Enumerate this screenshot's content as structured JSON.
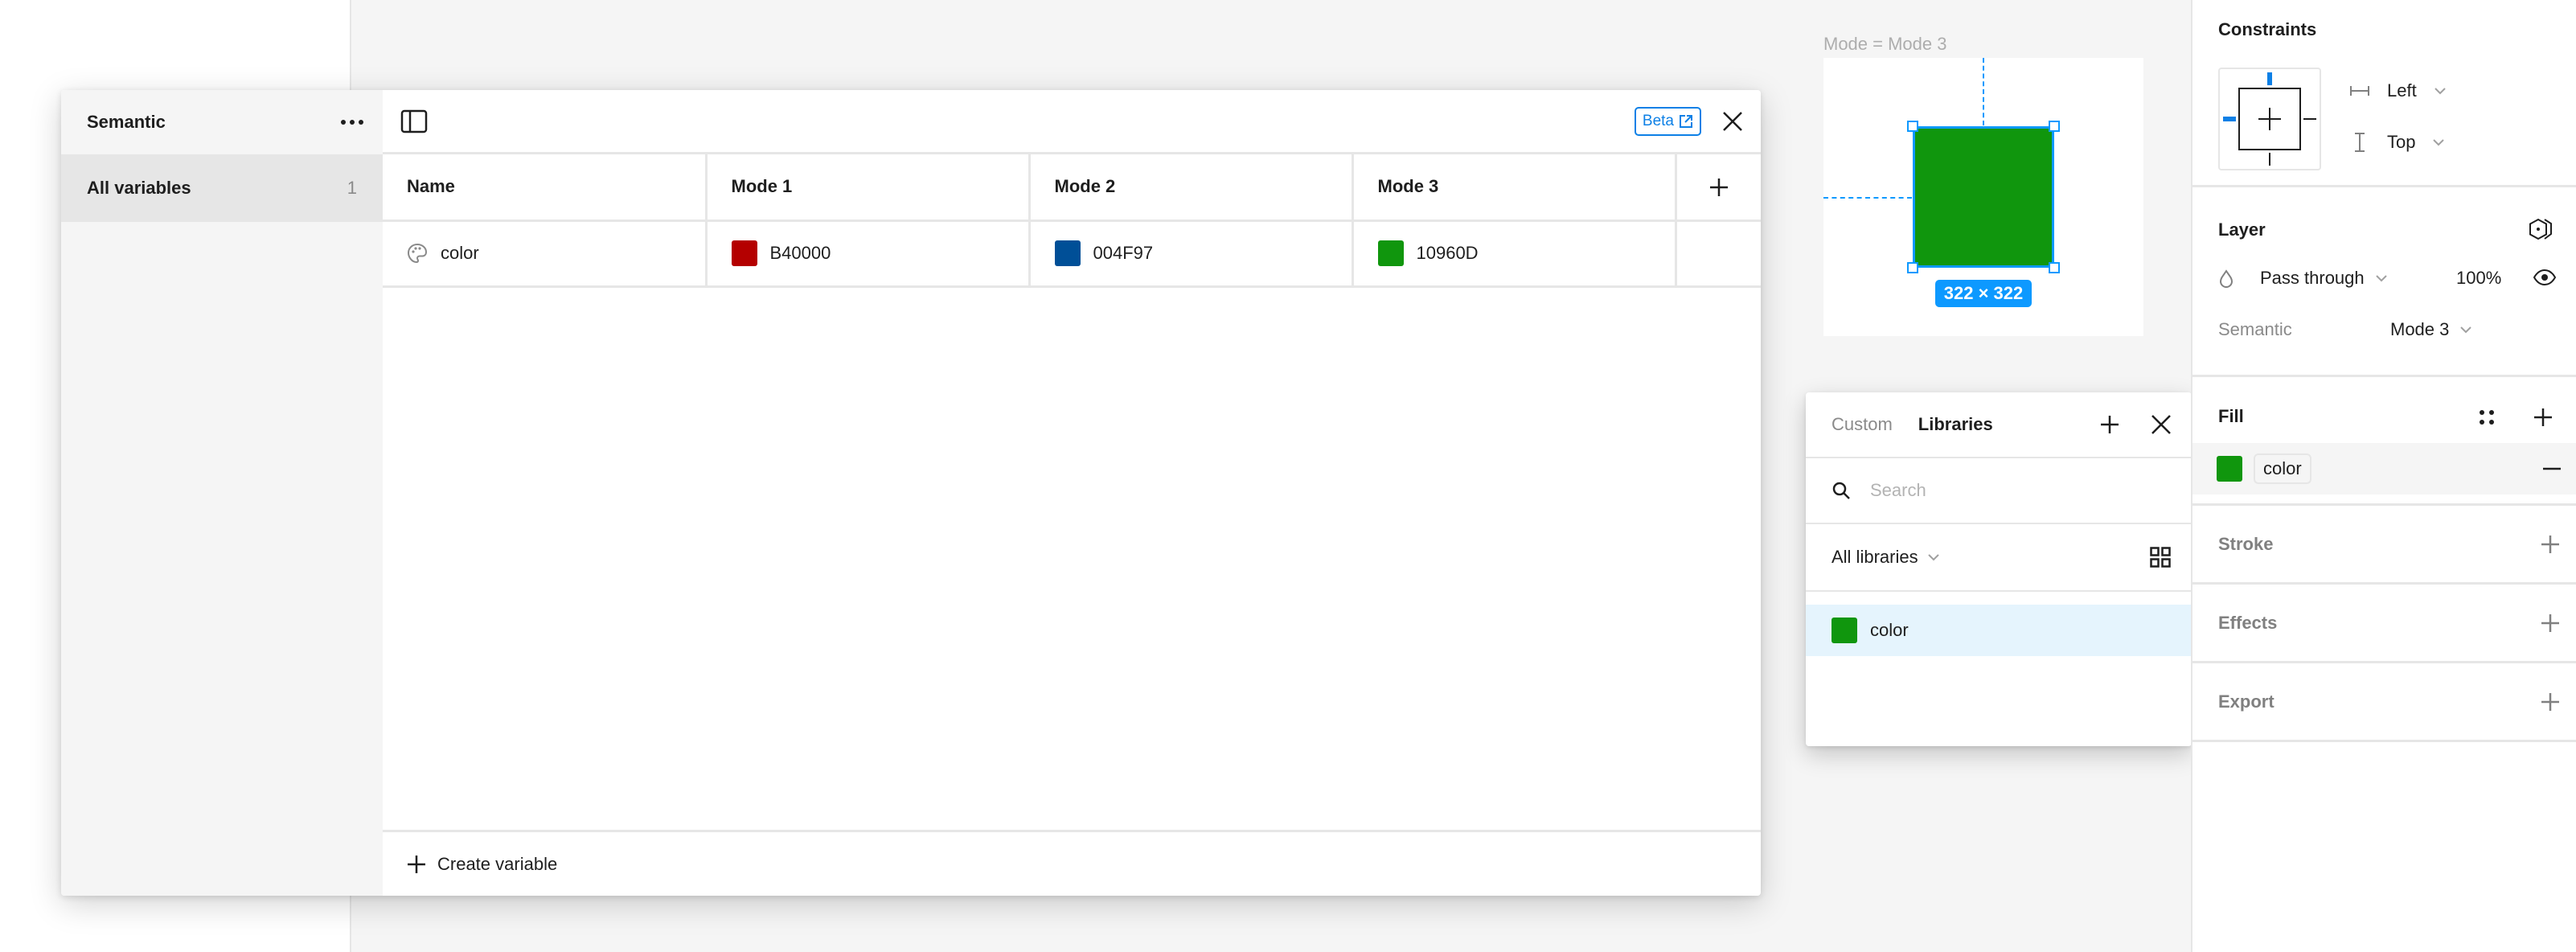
{
  "canvas": {
    "frame_label": "Mode = Mode 3",
    "selection_size": "322 × 322",
    "rect_color": "#10960D",
    "selection_color": "#0d99ff"
  },
  "variables_dialog": {
    "collection_name": "Semantic",
    "sidebar_items": [
      {
        "label": "All variables",
        "count": "1"
      }
    ],
    "beta_label": "Beta",
    "columns": [
      "Name",
      "Mode 1",
      "Mode 2",
      "Mode 3"
    ],
    "rows": [
      {
        "name": "color",
        "values": [
          {
            "hex": "B40000",
            "color": "#B40000"
          },
          {
            "hex": "004F97",
            "color": "#004F97"
          },
          {
            "hex": "10960D",
            "color": "#10960D"
          }
        ]
      }
    ],
    "create_variable_label": "Create variable"
  },
  "library_picker": {
    "tabs": [
      {
        "label": "Custom",
        "active": false
      },
      {
        "label": "Libraries",
        "active": true
      }
    ],
    "search_placeholder": "Search",
    "search_value": "",
    "filter_label": "All libraries",
    "items": [
      {
        "label": "color",
        "color": "#10960D",
        "selected": true
      }
    ]
  },
  "properties": {
    "constraints": {
      "title": "Constraints",
      "horizontal": "Left",
      "vertical": "Top"
    },
    "layer": {
      "title": "Layer",
      "blend_mode": "Pass through",
      "opacity": "100%",
      "mode_collection": "Semantic",
      "mode_value": "Mode 3"
    },
    "fill": {
      "title": "Fill",
      "variable_name": "color",
      "swatch_color": "#10960D"
    },
    "stroke_title": "Stroke",
    "effects_title": "Effects",
    "export_title": "Export"
  }
}
